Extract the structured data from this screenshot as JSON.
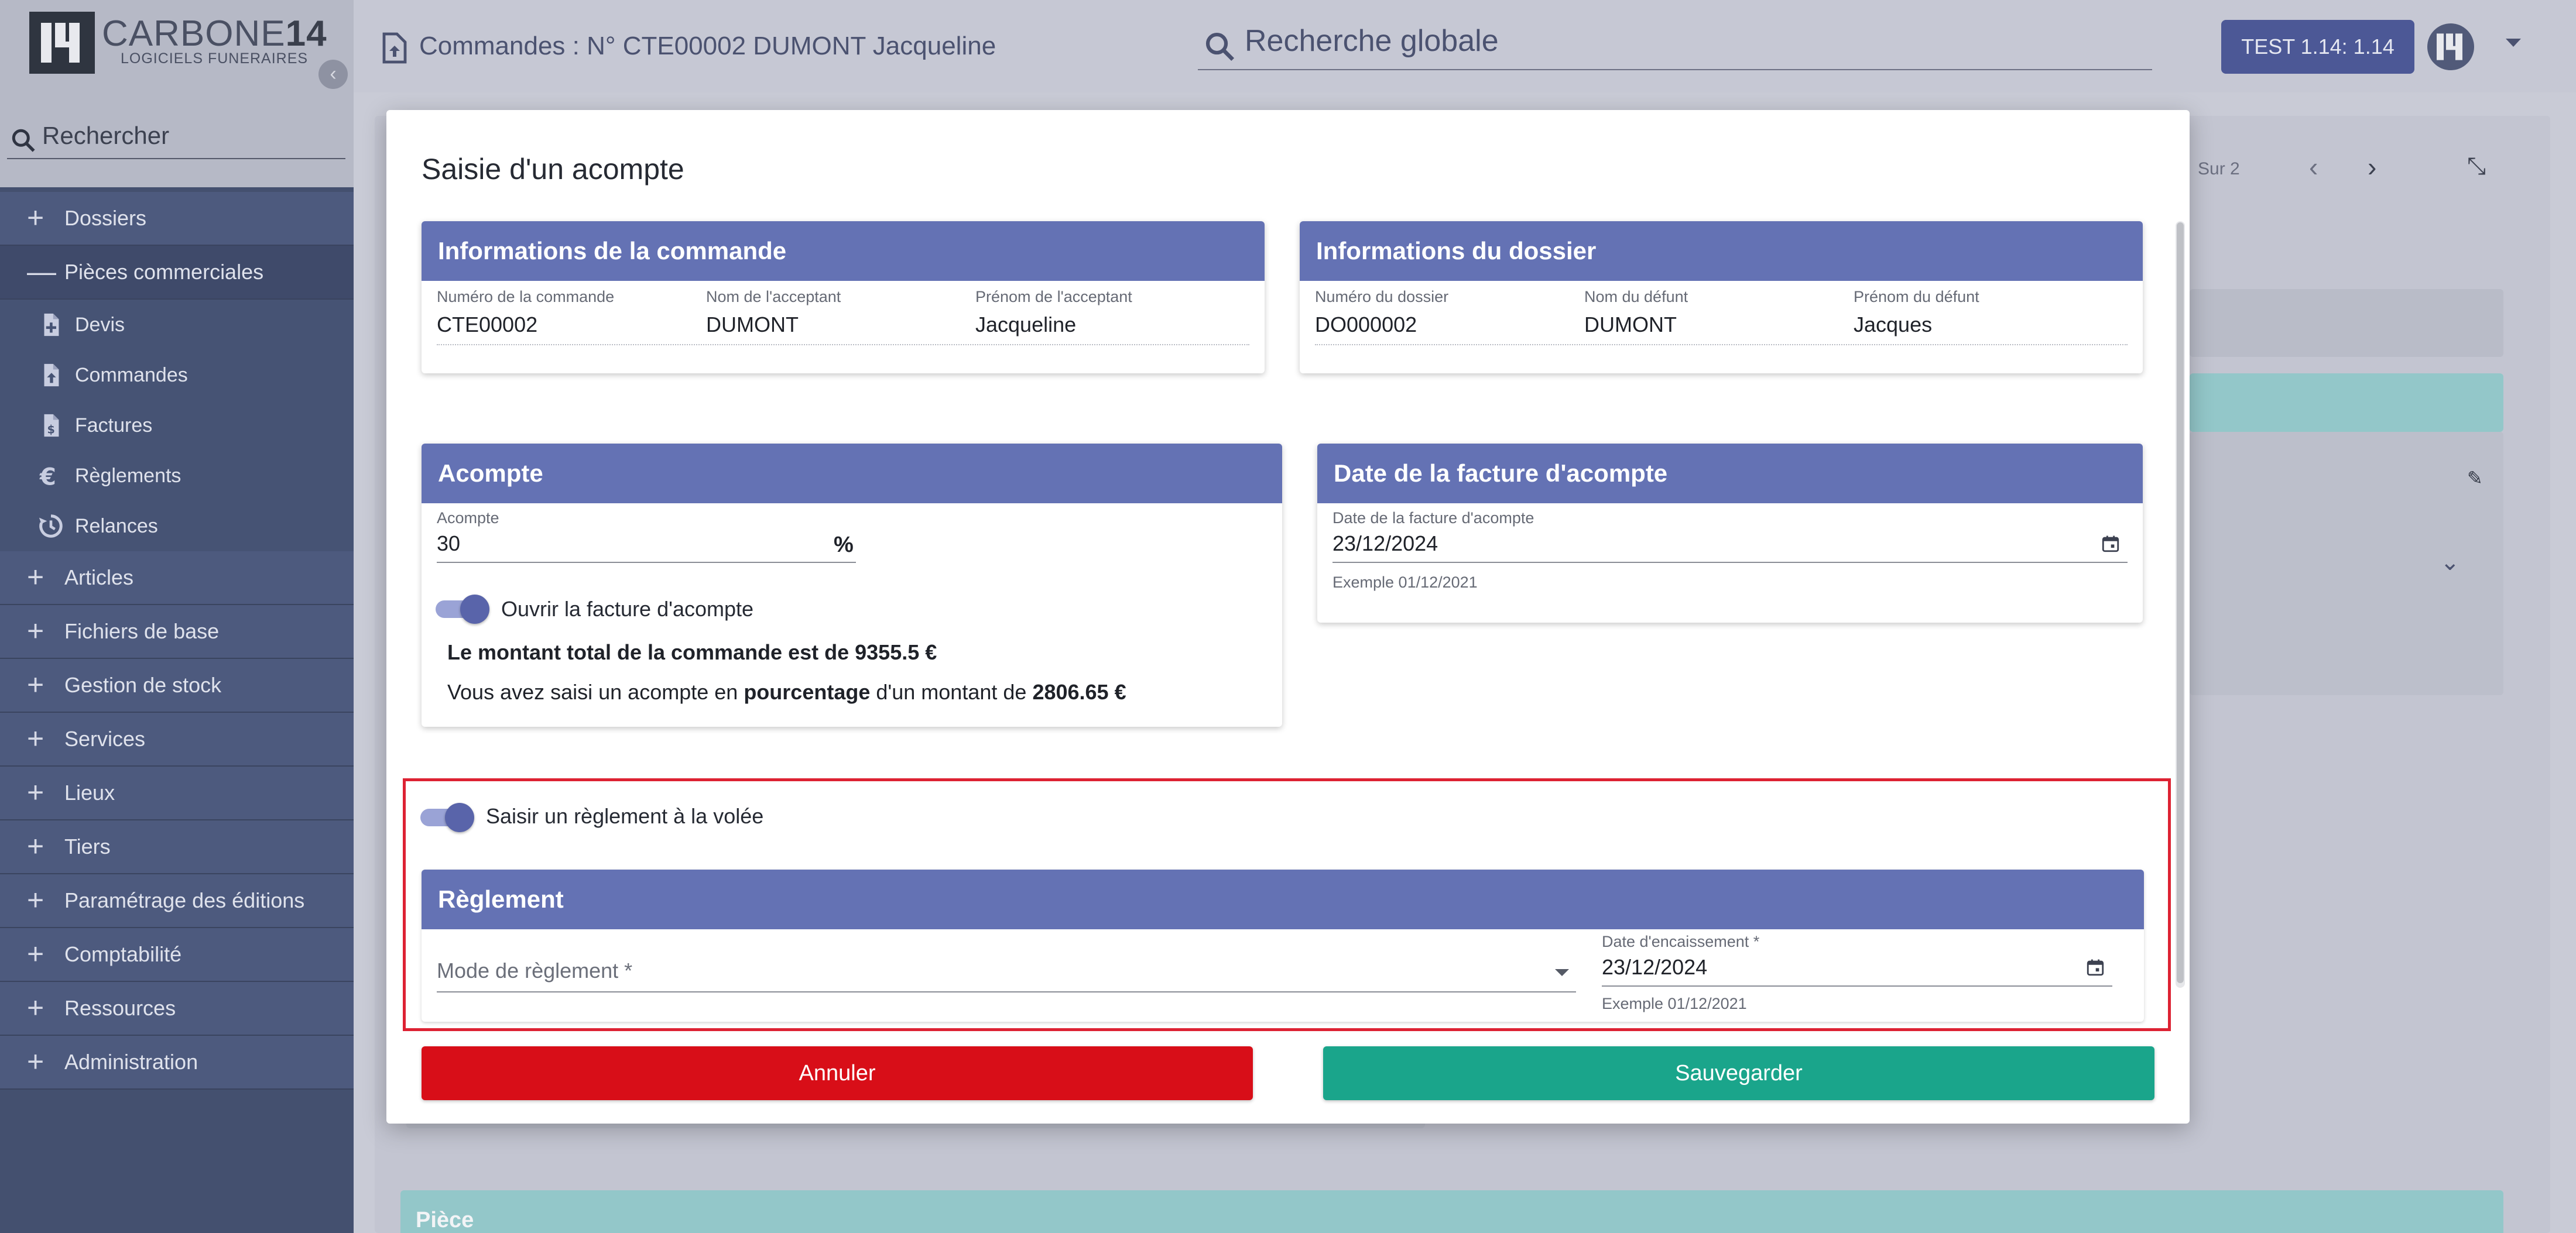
{
  "brand": {
    "name_light": "CARBONE",
    "name_bold": "14",
    "subtitle": "LOGICIELS FUNERAIRES"
  },
  "sidebar": {
    "search_placeholder": "Rechercher",
    "items": [
      {
        "label": "Dossiers",
        "open": false
      },
      {
        "label": "Pièces commerciales",
        "open": true
      },
      {
        "label": "Articles"
      },
      {
        "label": "Fichiers de base"
      },
      {
        "label": "Gestion de stock"
      },
      {
        "label": "Services"
      },
      {
        "label": "Lieux"
      },
      {
        "label": "Tiers"
      },
      {
        "label": "Paramétrage des éditions"
      },
      {
        "label": "Comptabilité"
      },
      {
        "label": "Ressources"
      },
      {
        "label": "Administration"
      }
    ],
    "subitems": [
      {
        "label": "Devis",
        "icon": "doc-plus-icon"
      },
      {
        "label": "Commandes",
        "icon": "doc-upload-icon"
      },
      {
        "label": "Factures",
        "icon": "doc-dollar-icon"
      },
      {
        "label": "Règlements",
        "icon": "euro-icon"
      },
      {
        "label": "Relances",
        "icon": "refresh-clock-icon"
      }
    ]
  },
  "header": {
    "title": "Commandes : N° CTE00002 DUMONT Jacqueline",
    "search_placeholder": "Recherche globale",
    "env_badge": "TEST 1.14: 1.14"
  },
  "background": {
    "pagination": "Sur 2",
    "section_label": "Pièce"
  },
  "modal": {
    "title": "Saisie d'un acompte",
    "order_info": {
      "header": "Informations de la commande",
      "fields": [
        {
          "label": "Numéro de la commande",
          "value": "CTE00002"
        },
        {
          "label": "Nom de l'acceptant",
          "value": "DUMONT"
        },
        {
          "label": "Prénom de l'acceptant",
          "value": "Jacqueline"
        }
      ]
    },
    "file_info": {
      "header": "Informations du dossier",
      "fields": [
        {
          "label": "Numéro du dossier",
          "value": "DO000002"
        },
        {
          "label": "Nom du défunt",
          "value": "DUMONT"
        },
        {
          "label": "Prénom du défunt",
          "value": "Jacques"
        }
      ]
    },
    "deposit": {
      "header": "Acompte",
      "field_label": "Acompte",
      "field_value": "30",
      "unit_symbol": "%",
      "toggle_label": "Ouvrir la facture d'acompte",
      "toggle_on": true,
      "total_text": "Le montant total de la commande est de 9355.5 €",
      "summary_prefix": "Vous avez saisi un acompte en ",
      "summary_mode": "pourcentage",
      "summary_mid": " d'un montant de ",
      "summary_amount": "2806.65 €"
    },
    "invoice_date": {
      "header": "Date de la facture d'acompte",
      "field_label": "Date de la facture d'acompte",
      "field_value": "23/12/2024",
      "hint": "Exemple 01/12/2021"
    },
    "quick_payment": {
      "toggle_label": "Saisir un règlement à la volée",
      "toggle_on": true,
      "header": "Règlement",
      "mode_placeholder": "Mode de règlement *",
      "date_label": "Date d'encaissement *",
      "date_value": "23/12/2024",
      "date_hint": "Exemple 01/12/2021"
    },
    "buttons": {
      "cancel": "Annuler",
      "save": "Sauvegarder"
    }
  },
  "colors": {
    "accent": "#6472b4",
    "sidebar": "#44506f",
    "cancel": "#d80e18",
    "save": "#1aa58b",
    "highlight_frame": "#dd2233"
  }
}
